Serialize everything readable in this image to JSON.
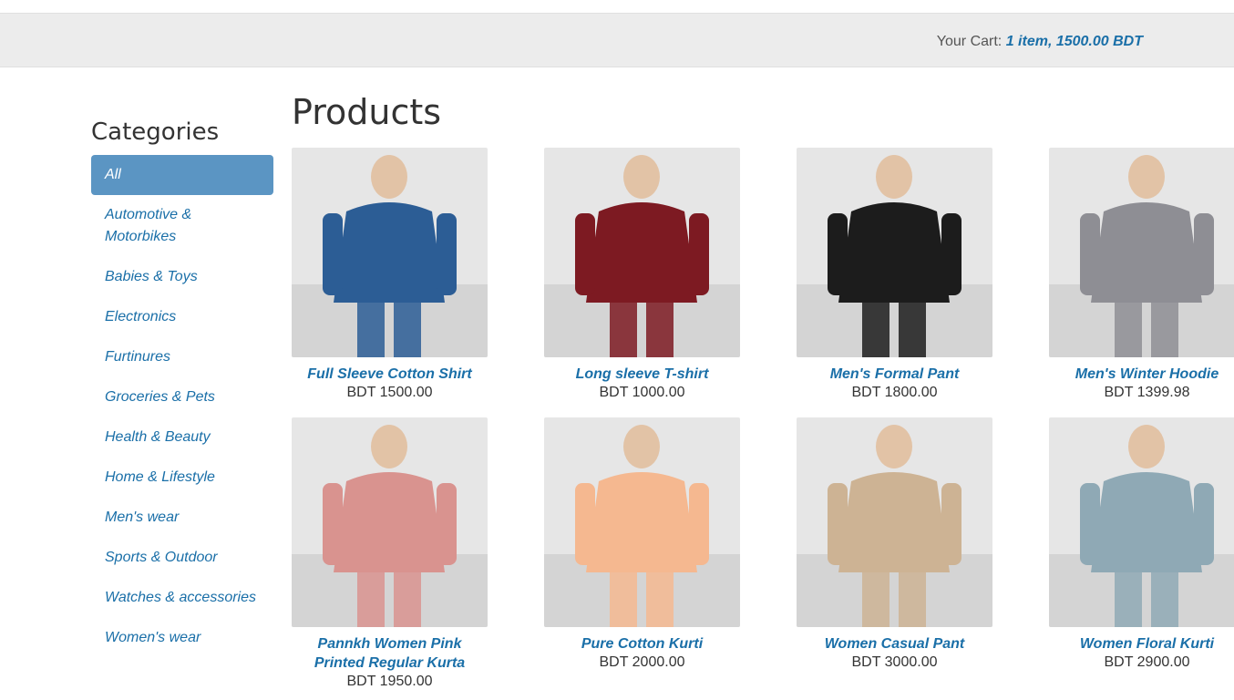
{
  "cart": {
    "label": "Your Cart:",
    "summary": "1 item, 1500.00 BDT"
  },
  "sidebar": {
    "title": "Categories",
    "items": [
      {
        "label": "All",
        "active": true
      },
      {
        "label": "Automotive & Motorbikes"
      },
      {
        "label": "Babies & Toys"
      },
      {
        "label": "Electronics"
      },
      {
        "label": "Furtinures"
      },
      {
        "label": "Groceries & Pets"
      },
      {
        "label": "Health & Beauty"
      },
      {
        "label": "Home & Lifestyle"
      },
      {
        "label": "Men's wear"
      },
      {
        "label": "Sports & Outdoor"
      },
      {
        "label": "Watches & accessories"
      },
      {
        "label": "Women's wear"
      }
    ]
  },
  "main": {
    "title": "Products",
    "products": [
      {
        "name": "Full Sleeve Cotton Shirt",
        "price": "BDT 1500.00",
        "image_color": "#2c5d95"
      },
      {
        "name": "Long sleeve T-shirt",
        "price": "BDT 1000.00",
        "image_color": "#7d1a22"
      },
      {
        "name": "Men's Formal Pant",
        "price": "BDT 1800.00",
        "image_color": "#1c1c1c"
      },
      {
        "name": "Men's Winter Hoodie",
        "price": "BDT 1399.98",
        "image_color": "#8e8e94"
      },
      {
        "name": "Pannkh Women Pink Printed Regular Kurta",
        "price": "BDT 1950.00",
        "image_color": "#d9938f"
      },
      {
        "name": "Pure Cotton Kurti",
        "price": "BDT 2000.00",
        "image_color": "#f5b890"
      },
      {
        "name": "Women Casual Pant",
        "price": "BDT 3000.00",
        "image_color": "#cdb394"
      },
      {
        "name": "Women Floral Kurti",
        "price": "BDT 2900.00",
        "image_color": "#8fa9b5"
      }
    ]
  }
}
